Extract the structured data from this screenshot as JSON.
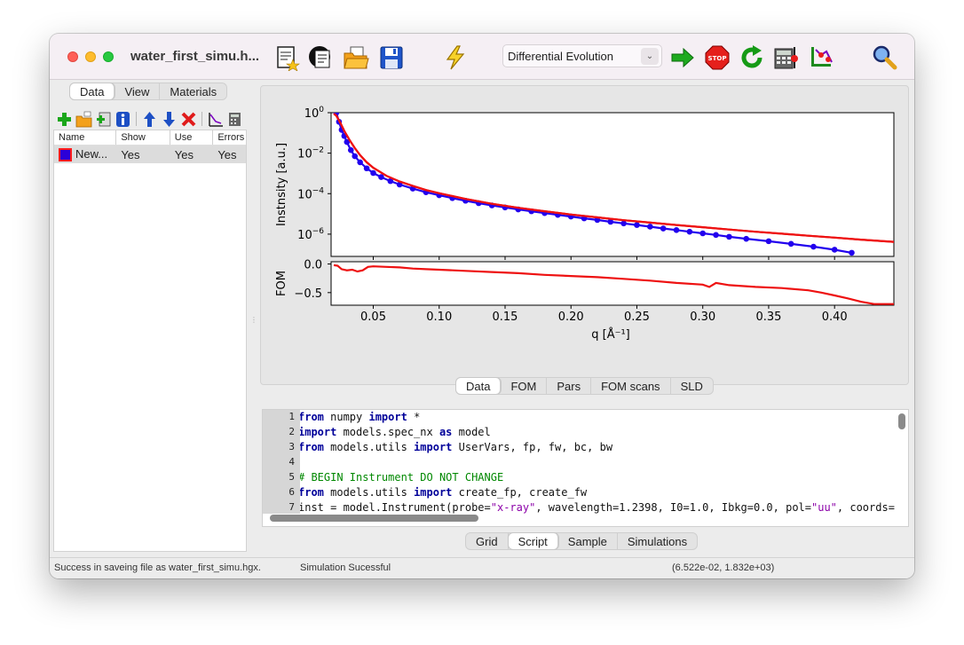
{
  "window": {
    "title": "water_first_simu.h..."
  },
  "toolbar": {
    "algorithm_selected": "Differential Evolution",
    "icons": [
      "new-model-icon",
      "simulate-model-icon",
      "open-folder-icon",
      "save-disk-icon",
      "lightning-icon",
      "go-arrow-icon",
      "stop-icon",
      "refresh-icon",
      "calculator-icon",
      "error-bars-icon",
      "zoom-icon"
    ]
  },
  "left_tabs": [
    {
      "label": "Data",
      "active": true
    },
    {
      "label": "View",
      "active": false
    },
    {
      "label": "Materials",
      "active": false
    }
  ],
  "data_list": {
    "columns": [
      "Name",
      "Show",
      "Use",
      "Errors"
    ],
    "rows": [
      {
        "name": "New...",
        "show": "Yes",
        "use": "Yes",
        "errors": "Yes",
        "color": "#2b00d8",
        "edge_color": "#ff1b1b"
      }
    ]
  },
  "plot_tabs": [
    {
      "label": "Data",
      "active": true
    },
    {
      "label": "FOM",
      "active": false
    },
    {
      "label": "Pars",
      "active": false
    },
    {
      "label": "FOM scans",
      "active": false
    },
    {
      "label": "SLD",
      "active": false
    }
  ],
  "bottom_tabs": [
    {
      "label": "Grid",
      "active": false
    },
    {
      "label": "Script",
      "active": true
    },
    {
      "label": "Sample",
      "active": false
    },
    {
      "label": "Simulations",
      "active": false
    }
  ],
  "script": [
    {
      "n": "1",
      "code": [
        [
          "kw",
          "from"
        ],
        [
          "t",
          " numpy "
        ],
        [
          "kw",
          "import"
        ],
        [
          "t",
          " *"
        ]
      ]
    },
    {
      "n": "2",
      "code": [
        [
          "kw",
          "import"
        ],
        [
          "t",
          " models.spec_nx "
        ],
        [
          "kw",
          "as"
        ],
        [
          "t",
          " model"
        ]
      ]
    },
    {
      "n": "3",
      "code": [
        [
          "kw",
          "from"
        ],
        [
          "t",
          " models.utils "
        ],
        [
          "kw",
          "import"
        ],
        [
          "t",
          " UserVars, fp, fw, bc, bw"
        ]
      ]
    },
    {
      "n": "4",
      "code": []
    },
    {
      "n": "5",
      "code": [
        [
          "cm",
          "# BEGIN Instrument DO NOT CHANGE"
        ]
      ]
    },
    {
      "n": "6",
      "code": [
        [
          "kw",
          "from"
        ],
        [
          "t",
          " models.utils "
        ],
        [
          "kw",
          "import"
        ],
        [
          "t",
          " create_fp, create_fw"
        ]
      ]
    },
    {
      "n": "7",
      "code": [
        [
          "t",
          "inst = model.Instrument(probe="
        ],
        [
          "st",
          "\"x-ray\""
        ],
        [
          "t",
          ", wavelength=1.2398, I0=1.0, Ibkg=0.0, pol="
        ],
        [
          "st",
          "\"uu\""
        ],
        [
          "t",
          ", coords="
        ]
      ]
    }
  ],
  "status": {
    "message": "Success in saveing file as water_first_simu.hgx.",
    "simulation": "Simulation Sucessful",
    "coords": "(6.522e-02, 1.832e+03)"
  },
  "chart_data": {
    "type": "line",
    "xlabel": "q [Å⁻¹]",
    "xlim": [
      0.018,
      0.445
    ],
    "x_ticks": [
      "0.05",
      "0.10",
      "0.15",
      "0.20",
      "0.25",
      "0.30",
      "0.35",
      "0.40"
    ],
    "top": {
      "ylabel": "Instnsity [a.u.]",
      "yscale": "log",
      "ylim_log10": [
        -7.1,
        0.0
      ],
      "y_ticks": [
        {
          "base": "10",
          "exp": "0",
          "log10": 0
        },
        {
          "base": "10",
          "exp": "−2",
          "log10": -2
        },
        {
          "base": "10",
          "exp": "−4",
          "log10": -4
        },
        {
          "base": "10",
          "exp": "−6",
          "log10": -6
        }
      ],
      "series": [
        {
          "color": "#2200ee",
          "marker": "circle",
          "x": [
            0.022,
            0.024,
            0.026,
            0.028,
            0.03,
            0.033,
            0.036,
            0.04,
            0.045,
            0.05,
            0.056,
            0.063,
            0.07,
            0.08,
            0.09,
            0.1,
            0.11,
            0.12,
            0.13,
            0.14,
            0.15,
            0.16,
            0.17,
            0.18,
            0.19,
            0.2,
            0.21,
            0.22,
            0.23,
            0.24,
            0.25,
            0.26,
            0.27,
            0.28,
            0.29,
            0.3,
            0.31,
            0.32,
            0.333,
            0.35,
            0.367,
            0.384,
            0.4,
            0.413
          ],
          "log10_y": [
            0.0,
            -0.45,
            -0.85,
            -1.15,
            -1.45,
            -1.85,
            -2.15,
            -2.45,
            -2.75,
            -2.98,
            -3.18,
            -3.38,
            -3.55,
            -3.75,
            -3.93,
            -4.08,
            -4.22,
            -4.35,
            -4.47,
            -4.58,
            -4.68,
            -4.78,
            -4.87,
            -4.96,
            -5.05,
            -5.13,
            -5.22,
            -5.3,
            -5.39,
            -5.47,
            -5.55,
            -5.63,
            -5.72,
            -5.8,
            -5.88,
            -5.96,
            -6.04,
            -6.13,
            -6.23,
            -6.35,
            -6.48,
            -6.62,
            -6.77,
            -6.92
          ]
        },
        {
          "color": "#ee1111",
          "marker": "none",
          "x": [
            0.02,
            0.022,
            0.025,
            0.028,
            0.032,
            0.036,
            0.04,
            0.045,
            0.05,
            0.06,
            0.07,
            0.08,
            0.09,
            0.1,
            0.12,
            0.14,
            0.16,
            0.18,
            0.2,
            0.22,
            0.24,
            0.26,
            0.28,
            0.3,
            0.32,
            0.34,
            0.36,
            0.38,
            0.4,
            0.42,
            0.445
          ],
          "log10_y": [
            -0.05,
            -0.15,
            -0.5,
            -0.9,
            -1.35,
            -1.75,
            -2.1,
            -2.45,
            -2.72,
            -3.12,
            -3.4,
            -3.62,
            -3.82,
            -3.98,
            -4.26,
            -4.5,
            -4.7,
            -4.87,
            -5.03,
            -5.17,
            -5.31,
            -5.43,
            -5.55,
            -5.66,
            -5.77,
            -5.88,
            -5.98,
            -6.08,
            -6.17,
            -6.27,
            -6.38
          ]
        }
      ]
    },
    "bottom": {
      "ylabel": "FOM",
      "ylim": [
        -0.72,
        0.04
      ],
      "y_ticks": [
        "0.0",
        "−0.5"
      ],
      "series": [
        {
          "color": "#ee1111",
          "x": [
            0.02,
            0.023,
            0.026,
            0.03,
            0.034,
            0.038,
            0.042,
            0.046,
            0.05,
            0.06,
            0.07,
            0.08,
            0.09,
            0.1,
            0.12,
            0.14,
            0.16,
            0.18,
            0.2,
            0.22,
            0.24,
            0.26,
            0.28,
            0.3,
            0.305,
            0.31,
            0.32,
            0.34,
            0.36,
            0.38,
            0.39,
            0.4,
            0.41,
            0.42,
            0.43,
            0.445
          ],
          "y": [
            -0.02,
            -0.03,
            -0.09,
            -0.11,
            -0.1,
            -0.13,
            -0.11,
            -0.05,
            -0.04,
            -0.05,
            -0.06,
            -0.08,
            -0.09,
            -0.1,
            -0.12,
            -0.14,
            -0.16,
            -0.19,
            -0.21,
            -0.23,
            -0.26,
            -0.29,
            -0.33,
            -0.36,
            -0.4,
            -0.33,
            -0.37,
            -0.4,
            -0.42,
            -0.46,
            -0.5,
            -0.55,
            -0.6,
            -0.66,
            -0.7,
            -0.7
          ]
        }
      ]
    }
  }
}
